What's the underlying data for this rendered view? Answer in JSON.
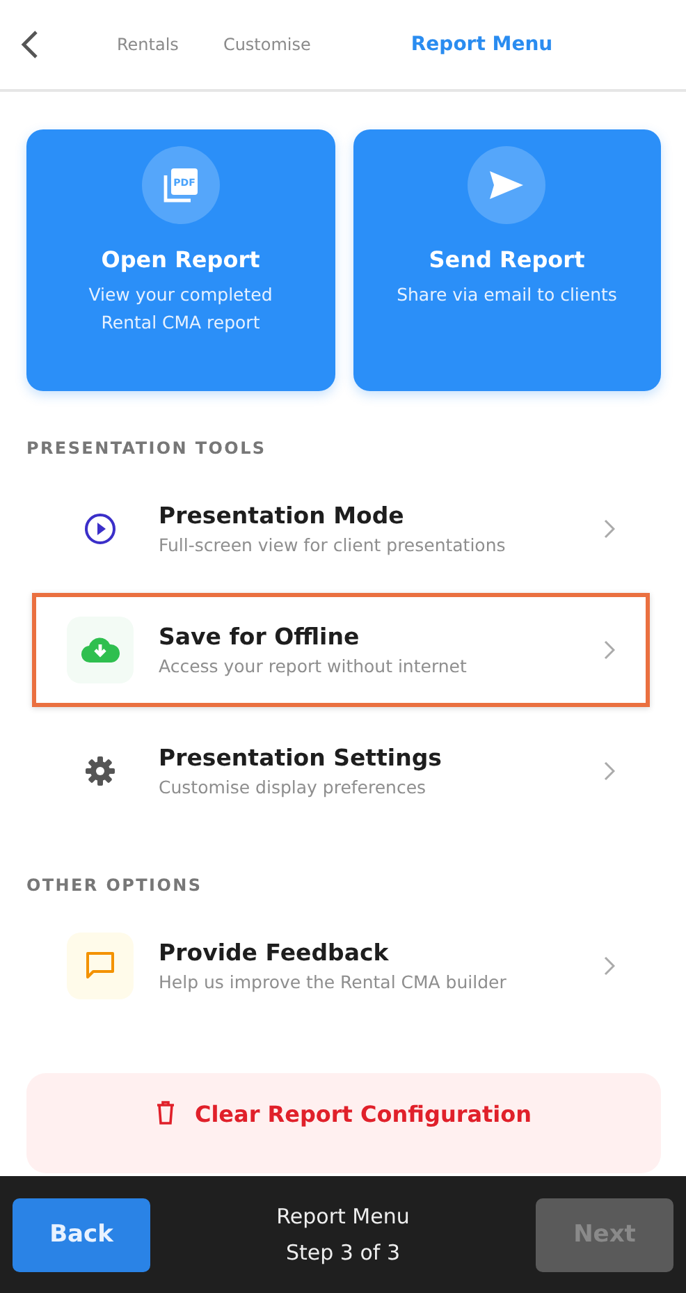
{
  "tabs": [
    {
      "label": "Rentals",
      "selected": false
    },
    {
      "label": "Customise",
      "selected": false
    },
    {
      "label": "Report Menu",
      "selected": true
    }
  ],
  "cards": [
    {
      "kind": "pdf",
      "icon_text": "PDF",
      "title": "Open Report",
      "subtitle": "View your completed Rental CMA report"
    },
    {
      "kind": "send",
      "title": "Send Report",
      "subtitle": "Share via email to clients"
    }
  ],
  "sections": [
    {
      "heading": "PRESENTATION TOOLS",
      "items": [
        {
          "kind": "play",
          "title": "Presentation Mode",
          "subtitle": "Full-screen view for client presentations",
          "highlighted": false
        },
        {
          "kind": "cloud",
          "title": "Save for Offline",
          "subtitle": "Access your report without internet",
          "highlighted": true
        },
        {
          "kind": "gear",
          "title": "Presentation Settings",
          "subtitle": "Customise display preferences",
          "highlighted": false
        }
      ]
    },
    {
      "heading": "OTHER OPTIONS",
      "items": [
        {
          "kind": "chat",
          "title": "Provide Feedback",
          "subtitle": "Help us improve the Rental CMA builder",
          "highlighted": false
        }
      ]
    }
  ],
  "clear_button": "Clear Report Configuration",
  "footer": {
    "back": "Back",
    "title": "Report Menu",
    "step": "Step 3 of 3",
    "next": {
      "label": "Next",
      "disabled": true
    }
  }
}
